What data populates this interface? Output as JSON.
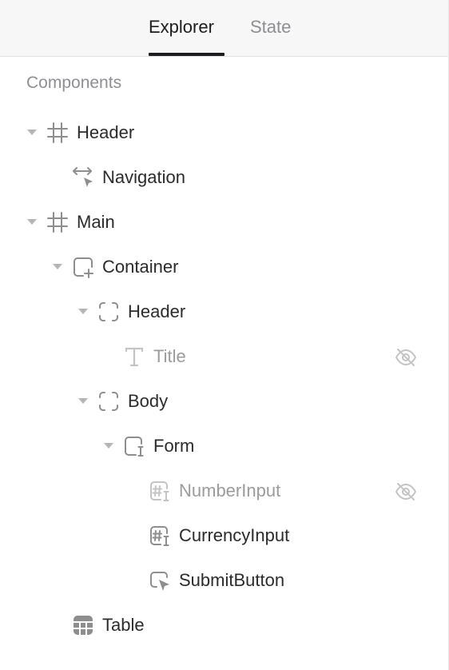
{
  "tabs": {
    "explorer": "Explorer",
    "state": "State"
  },
  "section_label": "Components",
  "tree": [
    {
      "label": "Header",
      "icon": "frame-grid-icon",
      "expanded": true,
      "hidden": false
    },
    {
      "label": "Navigation",
      "icon": "navigation-arrows-icon",
      "expanded": false,
      "hidden": false
    },
    {
      "label": "Main",
      "icon": "frame-grid-icon",
      "expanded": true,
      "hidden": false
    },
    {
      "label": "Container",
      "icon": "container-add-icon",
      "expanded": true,
      "hidden": false
    },
    {
      "label": "Header",
      "icon": "dashed-frame-icon",
      "expanded": true,
      "hidden": false
    },
    {
      "label": "Title",
      "icon": "text-icon",
      "expanded": false,
      "hidden": true
    },
    {
      "label": "Body",
      "icon": "dashed-frame-icon",
      "expanded": true,
      "hidden": false
    },
    {
      "label": "Form",
      "icon": "form-icon",
      "expanded": true,
      "hidden": false
    },
    {
      "label": "NumberInput",
      "icon": "number-input-icon",
      "expanded": false,
      "hidden": true
    },
    {
      "label": "CurrencyInput",
      "icon": "number-input-icon",
      "expanded": false,
      "hidden": false
    },
    {
      "label": "SubmitButton",
      "icon": "button-cursor-icon",
      "expanded": false,
      "hidden": false
    },
    {
      "label": "Table",
      "icon": "table-icon",
      "expanded": false,
      "hidden": false
    }
  ],
  "colors": {
    "text": "#2b2b2b",
    "muted_text": "#9b9b9b",
    "icon": "#8e8e8e",
    "muted_icon": "#c4c4c4",
    "tabbar_bg": "#f7f7f7"
  }
}
